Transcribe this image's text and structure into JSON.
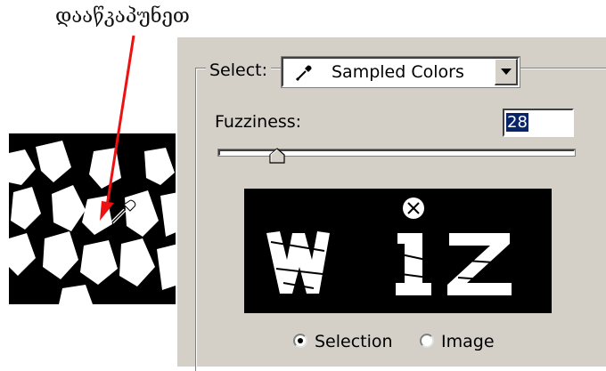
{
  "annotation": {
    "text": "დააწკაპუნეთ"
  },
  "dialog": {
    "select": {
      "label": "Select:",
      "value": "Sampled Colors",
      "icon": "eyedropper-icon"
    },
    "fuzziness": {
      "label": "Fuzziness:",
      "value": "28",
      "slider_fraction": 0.28
    },
    "radios": [
      {
        "label": "Selection",
        "checked": true
      },
      {
        "label": "Image",
        "checked": false
      }
    ]
  },
  "colors": {
    "arrow": "#ee1111",
    "dialog_bg": "#d4d0c8",
    "highlight": "#0a246a"
  }
}
